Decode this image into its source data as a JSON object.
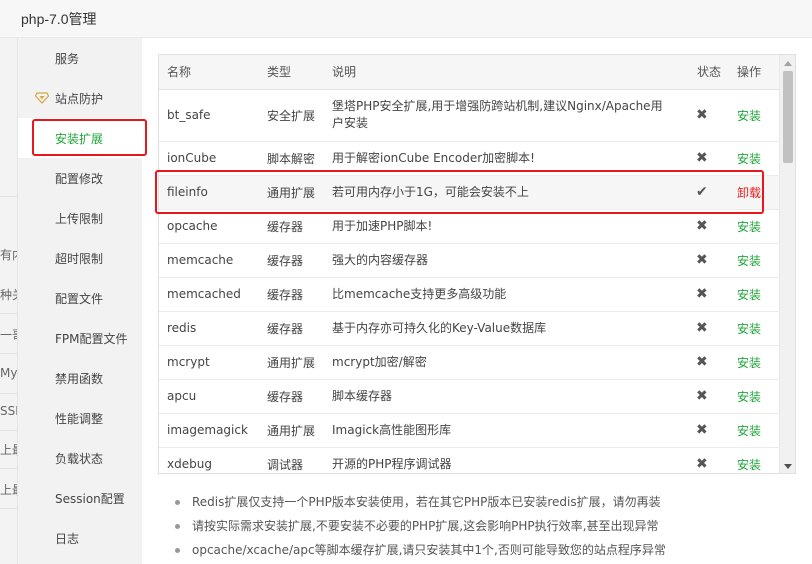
{
  "window": {
    "title": "php-7.0管理"
  },
  "background_fragments": [
    "有内",
    "种关",
    "一哥",
    "MyS",
    "SSH",
    "上最",
    "上最"
  ],
  "sidebar": {
    "items": [
      {
        "label": "服务"
      },
      {
        "label": "站点防护",
        "icon": "shield-diamond-icon"
      },
      {
        "label": "安装扩展"
      },
      {
        "label": "配置修改"
      },
      {
        "label": "上传限制"
      },
      {
        "label": "超时限制"
      },
      {
        "label": "配置文件"
      },
      {
        "label": "FPM配置文件"
      },
      {
        "label": "禁用函数"
      },
      {
        "label": "性能调整"
      },
      {
        "label": "负载状态"
      },
      {
        "label": "Session配置"
      },
      {
        "label": "日志"
      }
    ],
    "active_index": 2
  },
  "table": {
    "headers": [
      "名称",
      "类型",
      "说明",
      "状态",
      "操作"
    ],
    "rows": [
      {
        "name": "bt_safe",
        "type": "安全扩展",
        "desc": "堡塔PHP安全扩展,用于增强防跨站机制,建议Nginx/Apache用户安装",
        "status": "✖",
        "action": "安装"
      },
      {
        "name": "ionCube",
        "type": "脚本解密",
        "desc": "用于解密ionCube Encoder加密脚本!",
        "status": "✖",
        "action": "安装"
      },
      {
        "name": "fileinfo",
        "type": "通用扩展",
        "desc": "若可用内存小于1G，可能会安装不上",
        "status": "✔",
        "action": "卸载"
      },
      {
        "name": "opcache",
        "type": "缓存器",
        "desc": "用于加速PHP脚本!",
        "status": "✖",
        "action": "安装"
      },
      {
        "name": "memcache",
        "type": "缓存器",
        "desc": "强大的内容缓存器",
        "status": "✖",
        "action": "安装"
      },
      {
        "name": "memcached",
        "type": "缓存器",
        "desc": "比memcache支持更多高级功能",
        "status": "✖",
        "action": "安装"
      },
      {
        "name": "redis",
        "type": "缓存器",
        "desc": "基于内存亦可持久化的Key-Value数据库",
        "status": "✖",
        "action": "安装"
      },
      {
        "name": "mcrypt",
        "type": "通用扩展",
        "desc": "mcrypt加密/解密",
        "status": "✖",
        "action": "安装"
      },
      {
        "name": "apcu",
        "type": "缓存器",
        "desc": "脚本缓存器",
        "status": "✖",
        "action": "安装"
      },
      {
        "name": "imagemagick",
        "type": "通用扩展",
        "desc": "Imagick高性能图形库",
        "status": "✖",
        "action": "安装"
      },
      {
        "name": "xdebug",
        "type": "调试器",
        "desc": "开源的PHP程序调试器",
        "status": "✖",
        "action": "安装"
      }
    ]
  },
  "tips": [
    "Redis扩展仅支持一个PHP版本安装使用，若在其它PHP版本已安装redis扩展，请勿再装",
    "请按实际需求安装扩展,不要安装不必要的PHP扩展,这会影响PHP执行效率,甚至出现异常",
    "opcache/xcache/apc等脚本缓存扩展,请只安装其中1个,否则可能导致您的站点程序异常"
  ],
  "colors": {
    "accent": "#20a53a",
    "danger": "#e62020",
    "annotation": "#e8171c"
  }
}
